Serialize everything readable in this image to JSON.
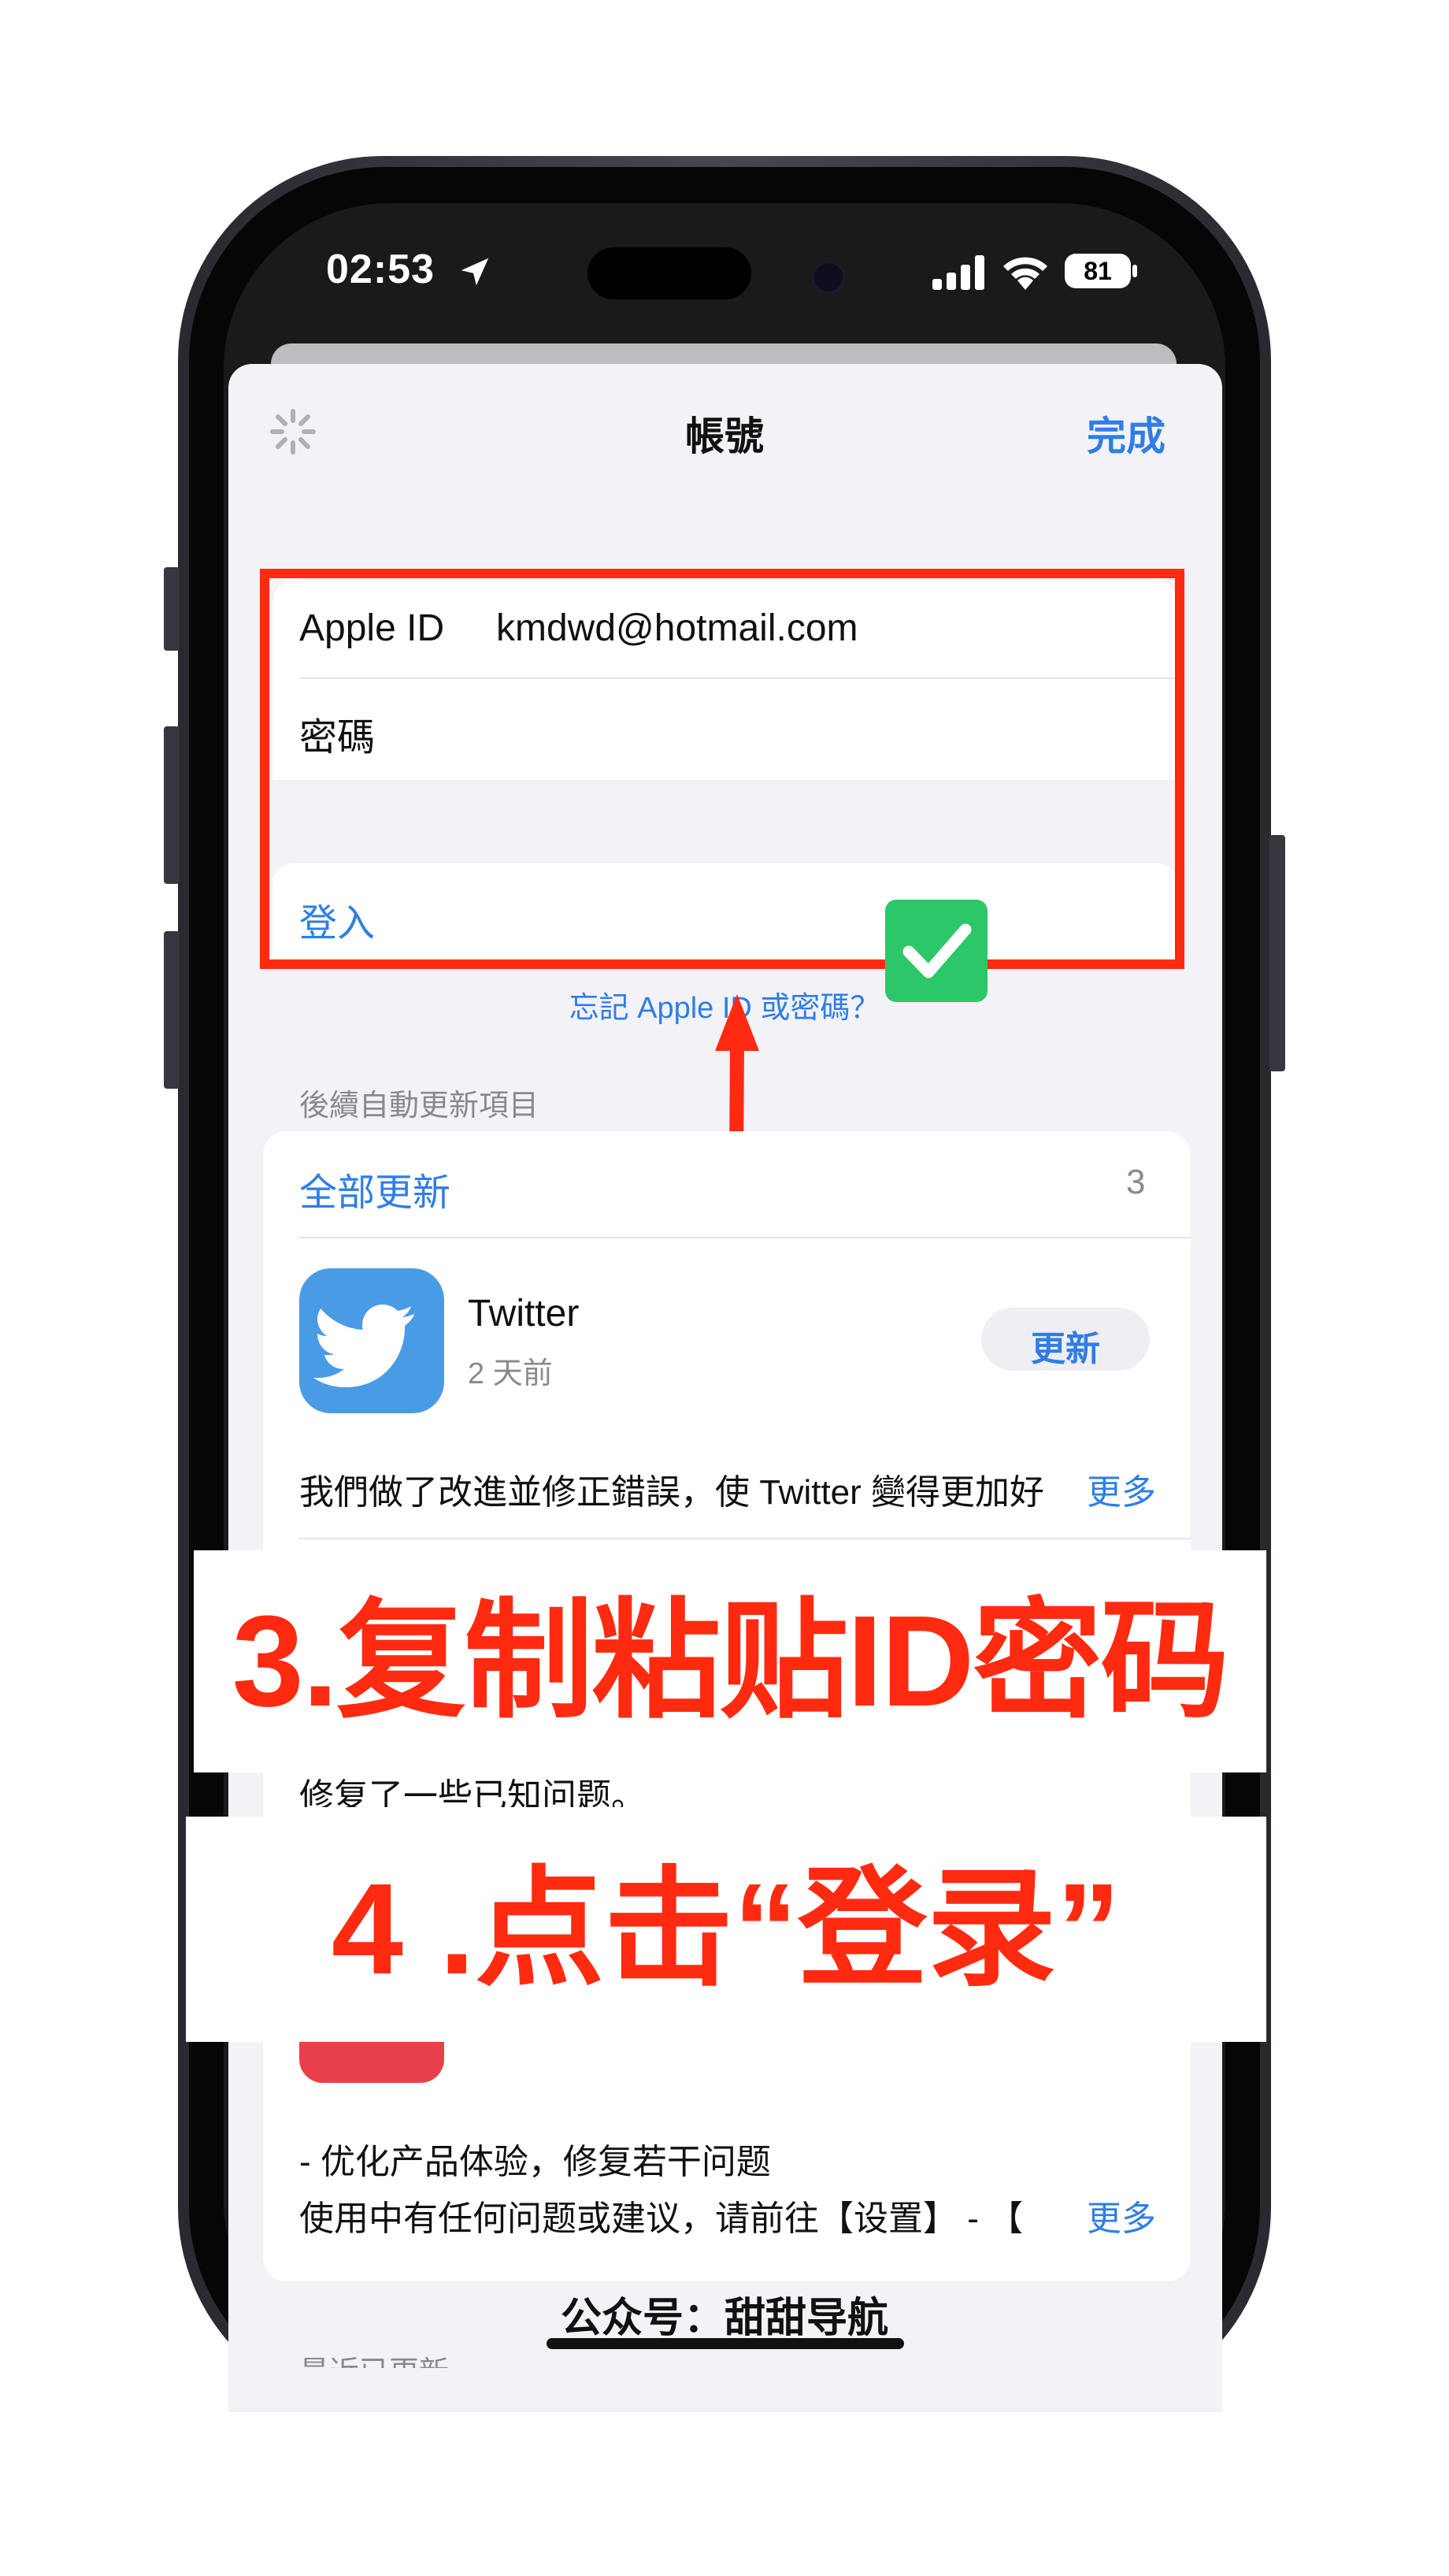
{
  "status_bar": {
    "time": "02:53",
    "battery": "81"
  },
  "nav": {
    "title": "帳號",
    "done": "完成"
  },
  "signin": {
    "apple_id_label": "Apple ID",
    "apple_id_value": "kmdwd@hotmail.com",
    "password_label": "密碼",
    "signin_button": "登入",
    "forgot": "忘記 Apple ID 或密碼？"
  },
  "updates": {
    "section_header": "後續自動更新項目",
    "update_all": "全部更新",
    "count": "3",
    "app1": {
      "name": "Twitter",
      "date": "2 天前",
      "button": "更新",
      "notes": "我們做了改進並修正錯誤，使 Twitter 變得更加好",
      "more": "更多"
    },
    "partial_notes": "修复了一些已知问题。",
    "app3_notes_line1": "- 优化产品体验，修复若干问题",
    "app3_notes_line2": "使用中有任何问题或建议，请前往【设置】 - 【",
    "app3_more": "更多",
    "recent_header": "最近已更新"
  },
  "annotations": {
    "step3": "3.复制粘贴ID密码",
    "step4": "4 .点击“登录”",
    "watermark": "公众号：甜甜导航"
  },
  "colors": {
    "accent": "#2f7ee6",
    "annotation_red": "#ff2a10",
    "check_green": "#2cc768",
    "twitter_blue": "#4a9be6"
  }
}
